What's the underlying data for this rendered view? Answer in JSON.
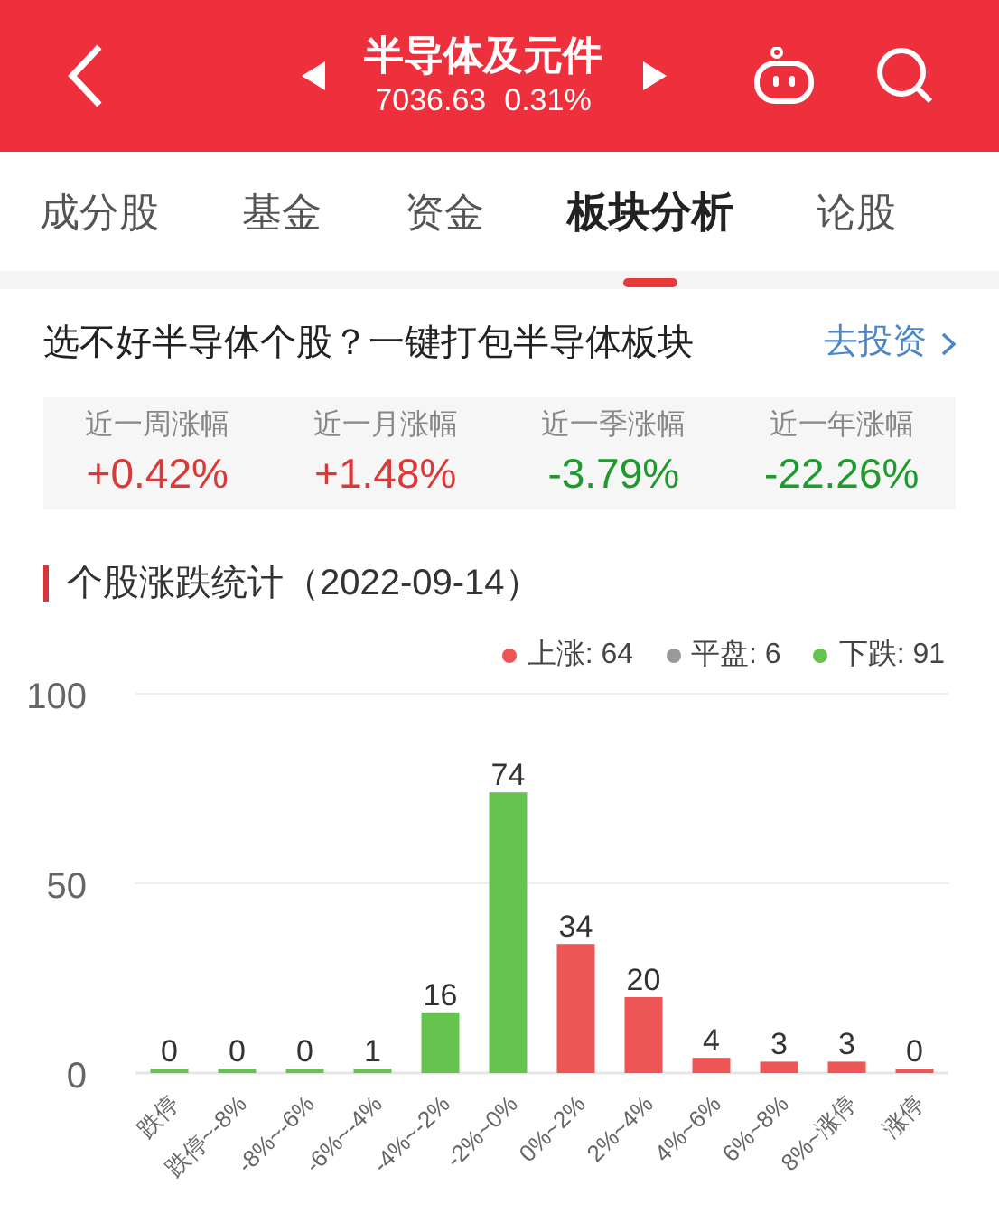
{
  "header": {
    "title": "半导体及元件",
    "price": "7036.63",
    "change": "0.31%"
  },
  "tabs": [
    {
      "label": "成分股",
      "selected": false
    },
    {
      "label": "基金",
      "selected": false
    },
    {
      "label": "资金",
      "selected": false
    },
    {
      "label": "板块分析",
      "selected": true
    },
    {
      "label": "论股",
      "selected": false
    }
  ],
  "promo": {
    "text": "选不好半导体个股？一键打包半导体板块",
    "link": "去投资"
  },
  "stats": [
    {
      "label": "近一周涨幅",
      "value": "+0.42%",
      "color": "#d83a3a"
    },
    {
      "label": "近一月涨幅",
      "value": "+1.48%",
      "color": "#d83a3a"
    },
    {
      "label": "近一季涨幅",
      "value": "-3.79%",
      "color": "#1e9a2e"
    },
    {
      "label": "近一年涨幅",
      "value": "-22.26%",
      "color": "#1e9a2e"
    }
  ],
  "section_title": "个股涨跌统计（2022-09-14）",
  "legend": [
    {
      "label": "上涨: 64",
      "color": "#ee5555"
    },
    {
      "label": "平盘: 6",
      "color": "#999999"
    },
    {
      "label": "下跌: 91",
      "color": "#66c34f"
    }
  ],
  "chart_data": {
    "type": "bar",
    "stacked": true,
    "data_labels": true,
    "ylim": [
      0,
      100
    ],
    "yticks": [
      0,
      50,
      100
    ],
    "categories": [
      "跌停",
      "跌停~-8%",
      "-8%~-6%",
      "-6%~-4%",
      "-4%~-2%",
      "-2%~0%",
      "0%~2%",
      "2%~4%",
      "4%~6%",
      "6%~8%",
      "8%~涨停",
      "涨停"
    ],
    "series": [
      {
        "color": "#66c34f",
        "values": [
          0,
          0,
          0,
          1,
          16,
          74,
          null,
          null,
          null,
          null,
          null,
          null
        ]
      },
      {
        "color": "#ee5555",
        "values": [
          null,
          null,
          null,
          null,
          null,
          null,
          34,
          20,
          4,
          3,
          3,
          0
        ]
      }
    ]
  }
}
